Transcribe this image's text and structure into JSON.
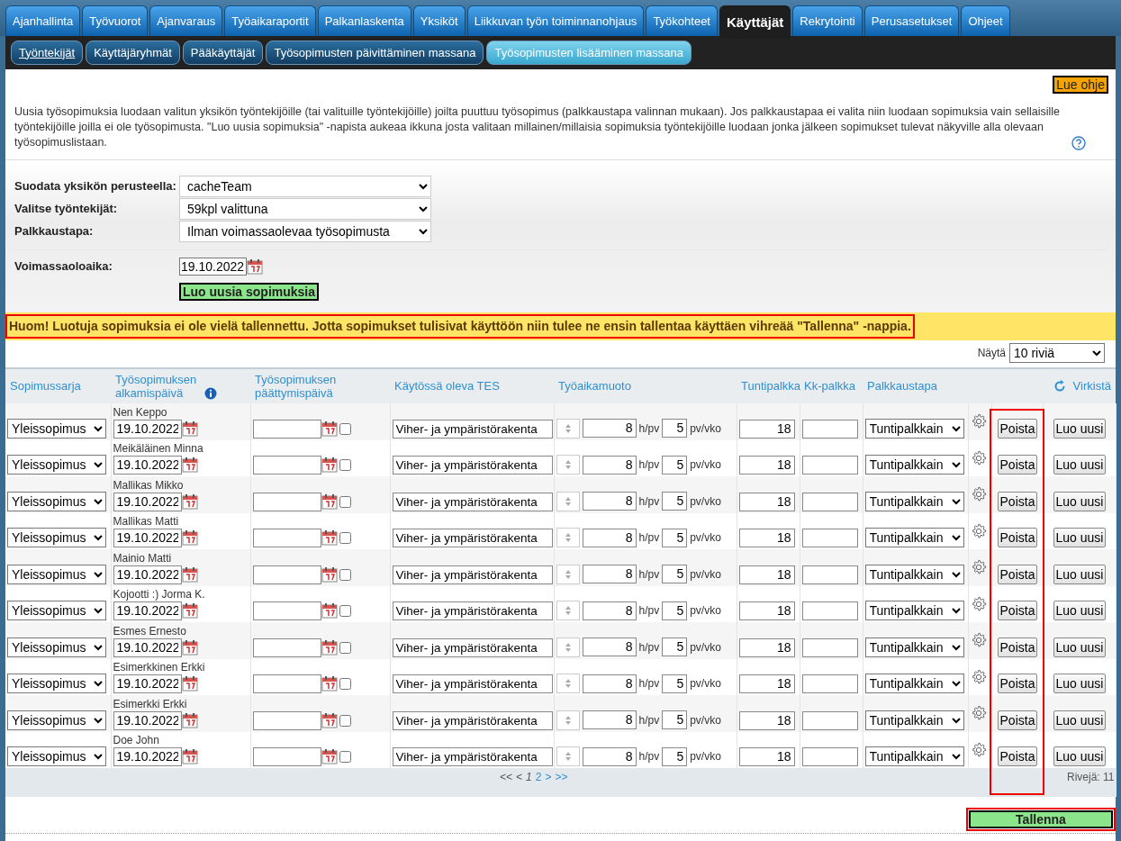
{
  "main_tabs": [
    {
      "label": "Ajanhallinta",
      "selected": false
    },
    {
      "label": "Työvuorot",
      "selected": false
    },
    {
      "label": "Ajanvaraus",
      "selected": false
    },
    {
      "label": "Työaikaraportit",
      "selected": false
    },
    {
      "label": "Palkanlaskenta",
      "selected": false
    },
    {
      "label": "Yksiköt",
      "selected": false
    },
    {
      "label": "Liikkuvan työn toiminnanohjaus",
      "selected": false
    },
    {
      "label": "Työkohteet",
      "selected": false
    },
    {
      "label": "Käyttäjät",
      "selected": true
    },
    {
      "label": "Rekrytointi",
      "selected": false
    },
    {
      "label": "Perusasetukset",
      "selected": false
    },
    {
      "label": "Ohjeet",
      "selected": false
    }
  ],
  "sub_tabs": [
    {
      "label": "Työntekijät",
      "selected": false,
      "underlined": true
    },
    {
      "label": "Käyttäjäryhmät",
      "selected": false,
      "underlined": false
    },
    {
      "label": "Pääkäyttäjät",
      "selected": false,
      "underlined": false
    },
    {
      "label": "Työsopimusten päivittäminen massana",
      "selected": false,
      "underlined": false
    },
    {
      "label": "Työsopimusten lisääminen massana",
      "selected": true,
      "underlined": false
    }
  ],
  "help_button": "Lue ohje",
  "description": "Uusia työsopimuksia luodaan valitun yksikön työntekijöille (tai valituille työntekijöille) joilta puuttuu työsopimus (palkkaustapa valinnan mukaan). Jos palkkaustapaa ei valita niin luodaan sopimuksia vain sellaisille työntekijöille joilla ei ole työsopimusta. \"Luo uusia sopimuksia\" -napista aukeaa ikkuna josta valitaan millainen/millaisia sopimuksia työntekijöille luodaan jonka jälkeen sopimukset tulevat näkyville alla olevaan työsopimuslistaan.",
  "filters": [
    {
      "kind": "select",
      "label": "Suodata yksikön perusteella:",
      "value": "cacheTeam"
    },
    {
      "kind": "select",
      "label": "Valitse työntekijät:",
      "value": "59kpl valittuna"
    },
    {
      "kind": "select",
      "label": "Palkkaustapa:",
      "value": "Ilman voimassaolevaa työsopimusta"
    },
    {
      "kind": "date",
      "label": "Voimassaoloaika:",
      "value": "19.10.2022"
    }
  ],
  "create_button": "Luo uusia sopimuksia",
  "warning": {
    "text": "Huom! Luotuja sopimuksia ei ole vielä tallennettu. Jotta sopimukset tulisivat käyttöön niin tulee ne ensin tallentaa käyttäen vihreää \"Tallenna\" -nappia.",
    "highlighted": true
  },
  "page_size": {
    "label": "Näytä",
    "value": "10 riviä"
  },
  "table": {
    "columns": [
      "Sopimussarja",
      "Työsopimuksen alkamispäivä",
      "Työsopimuksen päättymispäivä",
      "Käytössä oleva TES",
      "Työaikamuoto",
      "Tuntipalkka",
      "Kk-palkka",
      "Palkkaustapa"
    ],
    "refresh": "Virkistä",
    "delete_column_highlighted": true,
    "rows": [
      {
        "name": "Nen Keppo",
        "series": "Yleissopimus",
        "start": "19.10.2022",
        "end_checked": false,
        "tes": "Viher- ja ympäristörakenta",
        "hours": "8",
        "hours_unit": "h/pv",
        "days": "5",
        "days_unit": "pv/vko",
        "hourly": "18",
        "pay_type": "Tuntipalkkain",
        "delete": "Poista",
        "create": "Luo uusi"
      },
      {
        "name": "Meikäläinen Minna",
        "series": "Yleissopimus",
        "start": "19.10.2022",
        "end_checked": false,
        "tes": "Viher- ja ympäristörakenta",
        "hours": "8",
        "hours_unit": "h/pv",
        "days": "5",
        "days_unit": "pv/vko",
        "hourly": "18",
        "pay_type": "Tuntipalkkain",
        "delete": "Poista",
        "create": "Luo uusi"
      },
      {
        "name": "Mallikas Mikko",
        "series": "Yleissopimus",
        "start": "19.10.2022",
        "end_checked": false,
        "tes": "Viher- ja ympäristörakenta",
        "hours": "8",
        "hours_unit": "h/pv",
        "days": "5",
        "days_unit": "pv/vko",
        "hourly": "18",
        "pay_type": "Tuntipalkkain",
        "delete": "Poista",
        "create": "Luo uusi"
      },
      {
        "name": "Mallikas Matti",
        "series": "Yleissopimus",
        "start": "19.10.2022",
        "end_checked": false,
        "tes": "Viher- ja ympäristörakenta",
        "hours": "8",
        "hours_unit": "h/pv",
        "days": "5",
        "days_unit": "pv/vko",
        "hourly": "18",
        "pay_type": "Tuntipalkkain",
        "delete": "Poista",
        "create": "Luo uusi"
      },
      {
        "name": "Mainio Matti",
        "series": "Yleissopimus",
        "start": "19.10.2022",
        "end_checked": false,
        "tes": "Viher- ja ympäristörakenta",
        "hours": "8",
        "hours_unit": "h/pv",
        "days": "5",
        "days_unit": "pv/vko",
        "hourly": "18",
        "pay_type": "Tuntipalkkain",
        "delete": "Poista",
        "create": "Luo uusi"
      },
      {
        "name": "Kojootti :) Jorma K.",
        "series": "Yleissopimus",
        "start": "19.10.2022",
        "end_checked": false,
        "tes": "Viher- ja ympäristörakenta",
        "hours": "8",
        "hours_unit": "h/pv",
        "days": "5",
        "days_unit": "pv/vko",
        "hourly": "18",
        "pay_type": "Tuntipalkkain",
        "delete": "Poista",
        "create": "Luo uusi"
      },
      {
        "name": "Esmes Ernesto",
        "series": "Yleissopimus",
        "start": "19.10.2022",
        "end_checked": false,
        "tes": "Viher- ja ympäristörakenta",
        "hours": "8",
        "hours_unit": "h/pv",
        "days": "5",
        "days_unit": "pv/vko",
        "hourly": "18",
        "pay_type": "Tuntipalkkain",
        "delete": "Poista",
        "create": "Luo uusi"
      },
      {
        "name": "Esimerkkinen Erkki",
        "series": "Yleissopimus",
        "start": "19.10.2022",
        "end_checked": false,
        "tes": "Viher- ja ympäristörakenta",
        "hours": "8",
        "hours_unit": "h/pv",
        "days": "5",
        "days_unit": "pv/vko",
        "hourly": "18",
        "pay_type": "Tuntipalkkain",
        "delete": "Poista",
        "create": "Luo uusi"
      },
      {
        "name": "Esimerkki Erkki",
        "series": "Yleissopimus",
        "start": "19.10.2022",
        "end_checked": false,
        "tes": "Viher- ja ympäristörakenta",
        "hours": "8",
        "hours_unit": "h/pv",
        "days": "5",
        "days_unit": "pv/vko",
        "hourly": "18",
        "pay_type": "Tuntipalkkain",
        "delete": "Poista",
        "create": "Luo uusi"
      },
      {
        "name": "Doe John",
        "series": "Yleissopimus",
        "start": "19.10.2022",
        "end_checked": false,
        "tes": "Viher- ja ympäristörakenta",
        "hours": "8",
        "hours_unit": "h/pv",
        "days": "5",
        "days_unit": "pv/vko",
        "hourly": "18",
        "pay_type": "Tuntipalkkain",
        "delete": "Poista",
        "create": "Luo uusi"
      }
    ]
  },
  "pager": {
    "first": "<<",
    "prev": "<",
    "pages": [
      {
        "label": "1",
        "selected": true
      },
      {
        "label": "2",
        "selected": false
      }
    ],
    "next": ">",
    "last": ">>"
  },
  "row_count": "Rivejä: 11",
  "save_button": {
    "label": "Tallenna",
    "highlighted": true
  }
}
